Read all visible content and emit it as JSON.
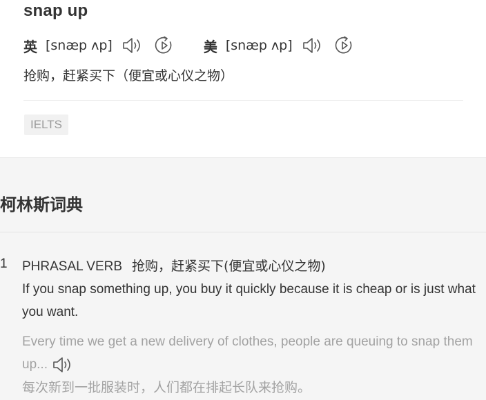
{
  "entry": {
    "word": "snap up",
    "pronunciations": [
      {
        "lang": "英",
        "phonetic": "[snæp ʌp]"
      },
      {
        "lang": "美",
        "phonetic": "[snæp ʌp]"
      }
    ],
    "definition": "抢购，赶紧买下（便宜或心仪之物）",
    "tags": [
      "IELTS"
    ]
  },
  "collins": {
    "title": "柯林斯词典",
    "items": [
      {
        "number": "1",
        "pos": "PHRASAL VERB",
        "cn_definition": "抢购，赶紧买下(便宜或心仪之物)",
        "en_definition": "If you snap something up, you buy it quickly because it is cheap or is just what you want.",
        "example_en": "Every time we get a new delivery of clothes, people are queuing to snap them up...",
        "example_cn": "每次新到一批服装时，人们都在排起长队来抢购。"
      }
    ]
  },
  "icons": {
    "speaker": "speaker-icon",
    "replay": "replay-icon"
  }
}
